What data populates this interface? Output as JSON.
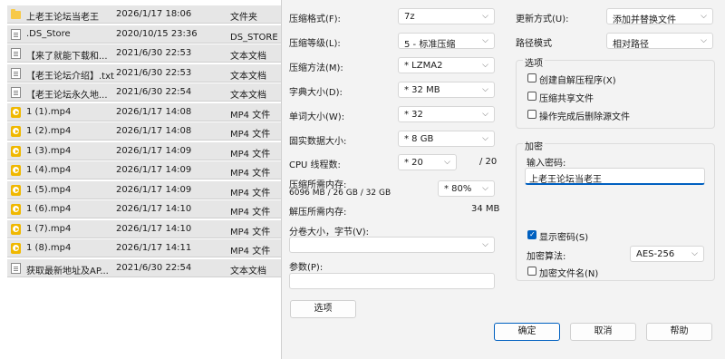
{
  "files": [
    {
      "icon": "folder-icon",
      "name": "上老王论坛当老王",
      "date": "2026/1/17 18:06",
      "type": "文件夹"
    },
    {
      "icon": "document-icon",
      "name": ".DS_Store",
      "date": "2020/10/15 23:36",
      "type": "DS_STORE 文件"
    },
    {
      "icon": "document-icon",
      "name": "【来了就能下载和...",
      "date": "2021/6/30 22:53",
      "type": "文本文档"
    },
    {
      "icon": "document-icon",
      "name": "【老王论坛介绍】.txt",
      "date": "2021/6/30 22:53",
      "type": "文本文档"
    },
    {
      "icon": "document-icon",
      "name": "【老王论坛永久地...",
      "date": "2021/6/30 22:54",
      "type": "文本文档"
    },
    {
      "icon": "video-icon",
      "name": "1 (1).mp4",
      "date": "2026/1/17 14:08",
      "type": "MP4 文件"
    },
    {
      "icon": "video-icon",
      "name": "1 (2).mp4",
      "date": "2026/1/17 14:08",
      "type": "MP4 文件"
    },
    {
      "icon": "video-icon",
      "name": "1 (3).mp4",
      "date": "2026/1/17 14:09",
      "type": "MP4 文件"
    },
    {
      "icon": "video-icon",
      "name": "1 (4).mp4",
      "date": "2026/1/17 14:09",
      "type": "MP4 文件"
    },
    {
      "icon": "video-icon",
      "name": "1 (5).mp4",
      "date": "2026/1/17 14:09",
      "type": "MP4 文件"
    },
    {
      "icon": "video-icon",
      "name": "1 (6).mp4",
      "date": "2026/1/17 14:10",
      "type": "MP4 文件"
    },
    {
      "icon": "video-icon",
      "name": "1 (7).mp4",
      "date": "2026/1/17 14:10",
      "type": "MP4 文件"
    },
    {
      "icon": "video-icon",
      "name": "1 (8).mp4",
      "date": "2026/1/17 14:11",
      "type": "MP4 文件"
    },
    {
      "icon": "document-icon",
      "name": "获取最新地址及AP...",
      "date": "2021/6/30 22:54",
      "type": "文本文档"
    }
  ],
  "left": {
    "format_label": "压缩格式(F):",
    "format_value": "7z",
    "level_label": "压缩等级(L):",
    "level_value": "5 - 标准压缩",
    "method_label": "压缩方法(M):",
    "method_value": "* LZMA2",
    "dict_label": "字典大小(D):",
    "dict_value": "* 32 MB",
    "word_label": "单词大小(W):",
    "word_value": "* 32",
    "solid_label": "固实数据大小:",
    "solid_value": "* 8 GB",
    "cpu_label": "CPU 线程数:",
    "cpu_value": "* 20",
    "cpu_max": "/ 20",
    "mem_label": "压缩所需内存:",
    "mem_detail": "6096 MB / 26 GB / 32 GB",
    "mem_value": "* 80%",
    "decomp_label": "解压所需内存:",
    "decomp_value": "34 MB",
    "volume_label": "分卷大小，字节(V):",
    "volume_value": "",
    "params_label": "参数(P):",
    "params_value": "",
    "options_button": "选项"
  },
  "right": {
    "update_label": "更新方式(U):",
    "update_value": "添加并替换文件",
    "path_label": "路径模式",
    "path_value": "相对路径",
    "options_title": "选项",
    "opt_sfx": "创建自解压程序(X)",
    "opt_shared": "压缩共享文件",
    "opt_delete": "操作完成后删除源文件",
    "encrypt_title": "加密",
    "password_label": "输入密码:",
    "password_value": "上老王论坛当老王",
    "show_password": "显示密码(S)",
    "algo_label": "加密算法:",
    "algo_value": "AES-256",
    "encrypt_names": "加密文件名(N)"
  },
  "buttons": {
    "ok": "确定",
    "cancel": "取消",
    "help": "帮助"
  },
  "colors": {
    "accent": "#0060c0",
    "selected_row": "#e6e6e6",
    "dialog_bg": "#f3f3f3"
  }
}
